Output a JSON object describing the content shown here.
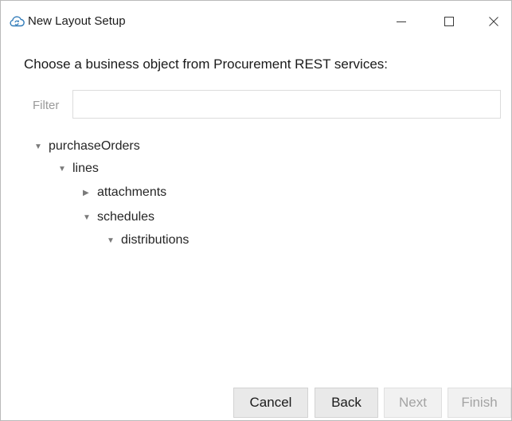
{
  "window": {
    "title": "New Layout Setup",
    "icon": "cloud-refresh-icon",
    "controls": [
      "minimize-icon",
      "maximize-icon",
      "close-icon"
    ]
  },
  "prompt": "Choose a business object from Procurement REST services:",
  "filter": {
    "label": "Filter",
    "value": "",
    "placeholder": ""
  },
  "tree": [
    {
      "label": "purchaseOrders",
      "expanded": true
    },
    {
      "label": "lines",
      "expanded": true
    },
    {
      "label": "attachments",
      "expanded": false
    },
    {
      "label": "schedules",
      "expanded": true
    },
    {
      "label": "distributions",
      "expanded": true
    }
  ],
  "buttons": {
    "cancel": "Cancel",
    "back": "Back",
    "next": "Next",
    "finish": "Finish"
  }
}
